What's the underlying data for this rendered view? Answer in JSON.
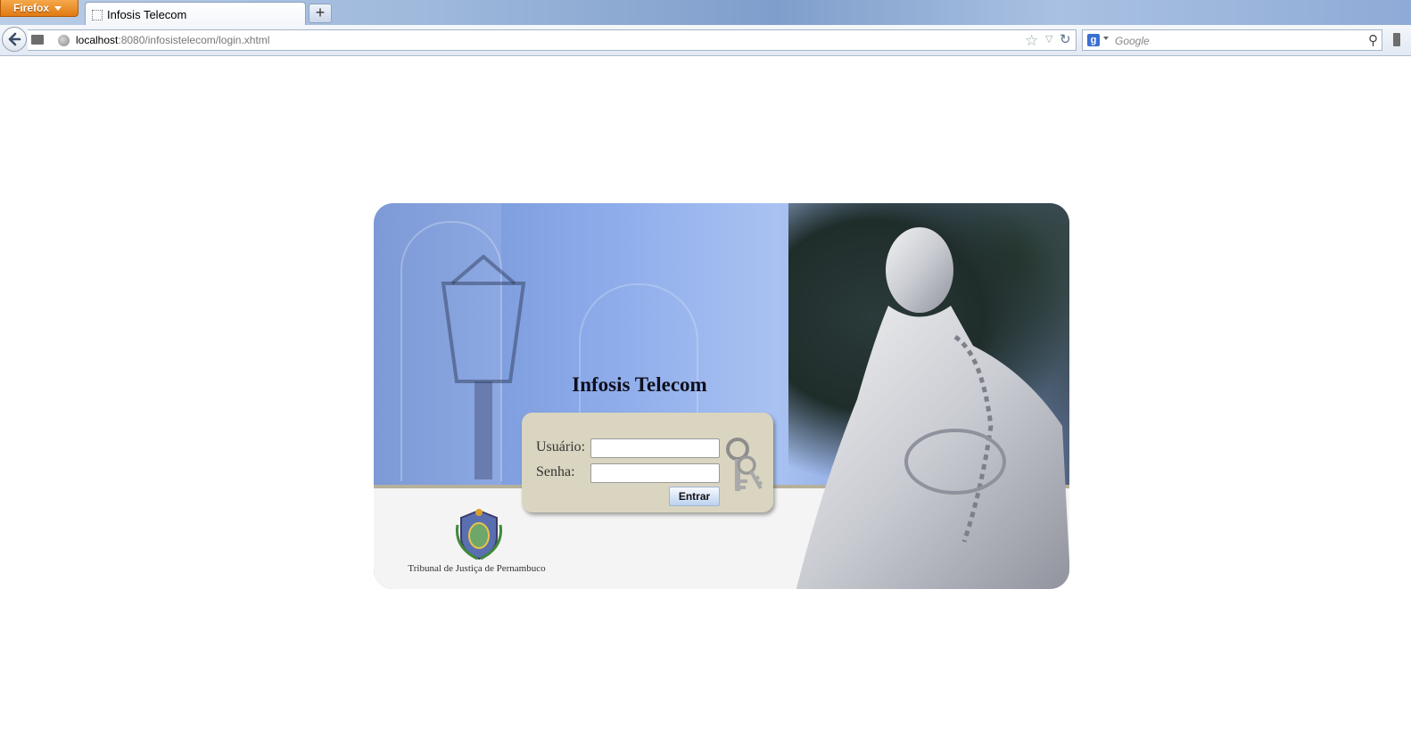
{
  "browser": {
    "menu_button": "Firefox",
    "tab_title": "Infosis Telecom",
    "new_tab": "+",
    "url_host": "localhost",
    "url_rest": ":8080/infosistelecom/login.xhtml",
    "search_engine_icon": "g-icon",
    "search_placeholder": "Google"
  },
  "page": {
    "title": "Infosis Telecom",
    "username_label": "Usuário:",
    "password_label": "Senha:",
    "username_value": "",
    "password_value": "",
    "submit_label": "Entrar",
    "footer_org": "Tribunal de Justiça de Pernambuco"
  },
  "colors": {
    "panel_blue": "#8fadeb",
    "login_box": "#d9d5c0",
    "button_blue": "#bcd2ef"
  }
}
